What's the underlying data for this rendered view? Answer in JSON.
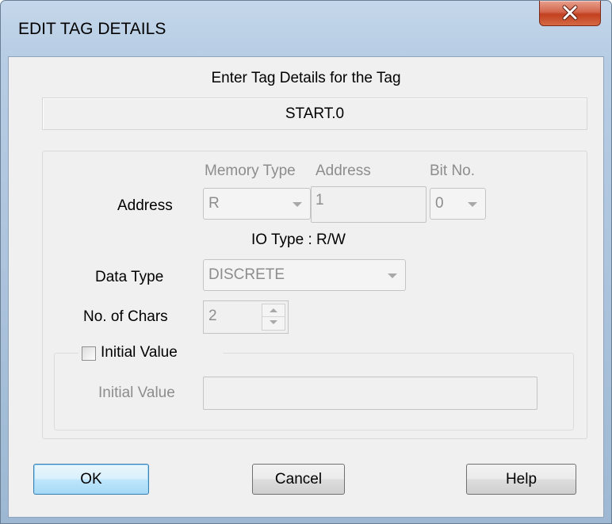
{
  "window": {
    "title": "EDIT TAG DETAILS",
    "close_icon": "close-icon"
  },
  "header": {
    "prompt": "Enter Tag Details for the Tag",
    "tag_name": "START.0"
  },
  "address": {
    "label": "Address",
    "memory_type_header": "Memory Type",
    "address_header": "Address",
    "bit_header": "Bit No.",
    "memory_type_value": "R",
    "address_value": "1",
    "bit_value": "0"
  },
  "io_type": "IO Type : R/W",
  "data_type": {
    "label": "Data Type",
    "value": "DISCRETE"
  },
  "chars": {
    "label": "No. of Chars",
    "value": "2"
  },
  "initial_value": {
    "checkbox_label": "Initial Value",
    "checked": false,
    "field_label": "Initial Value",
    "value": ""
  },
  "buttons": {
    "ok": "OK",
    "cancel": "Cancel",
    "help": "Help"
  },
  "colors": {
    "close_red": "#c2401f",
    "frame_blue": "#b7cde4",
    "default_button_blue": "#3c7fb1",
    "disabled_text": "#8d8d8d"
  }
}
